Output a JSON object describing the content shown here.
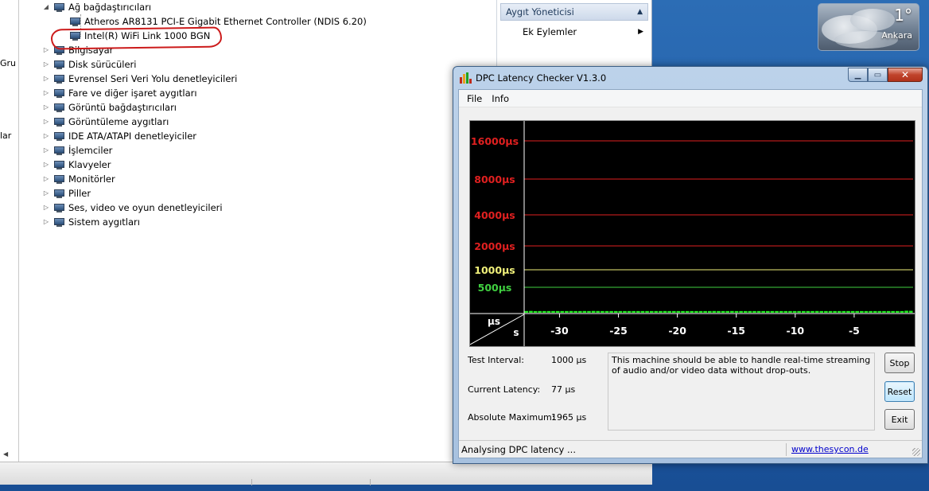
{
  "background_window": {
    "left_edge_texts": [
      "Gru",
      "lar"
    ],
    "tree": [
      {
        "label": "Ağ bağdaştırıcıları",
        "indent": 1,
        "expanded": true,
        "icon": "network-adapter-icon"
      },
      {
        "label": "Atheros AR8131 PCI-E Gigabit Ethernet Controller (NDIS 6.20)",
        "indent": 2,
        "expanded": null,
        "icon": "network-card-icon"
      },
      {
        "label": "Intel(R) WiFi Link 1000 BGN",
        "indent": 2,
        "expanded": null,
        "icon": "wifi-card-icon"
      },
      {
        "label": "Bilgisayar",
        "indent": 0,
        "expanded": false,
        "icon": "computer-icon"
      },
      {
        "label": "Disk sürücüleri",
        "indent": 0,
        "expanded": false,
        "icon": "disk-drive-icon"
      },
      {
        "label": "Evrensel Seri Veri Yolu denetleyicileri",
        "indent": 0,
        "expanded": false,
        "icon": "usb-icon"
      },
      {
        "label": "Fare ve diğer işaret aygıtları",
        "indent": 0,
        "expanded": false,
        "icon": "mouse-icon"
      },
      {
        "label": "Görüntü bağdaştırıcıları",
        "indent": 0,
        "expanded": false,
        "icon": "display-adapter-icon"
      },
      {
        "label": "Görüntüleme aygıtları",
        "indent": 0,
        "expanded": false,
        "icon": "camera-icon"
      },
      {
        "label": "IDE ATA/ATAPI denetleyiciler",
        "indent": 0,
        "expanded": false,
        "icon": "ide-controller-icon"
      },
      {
        "label": "İşlemciler",
        "indent": 0,
        "expanded": false,
        "icon": "processor-icon"
      },
      {
        "label": "Klavyeler",
        "indent": 0,
        "expanded": false,
        "icon": "keyboard-icon"
      },
      {
        "label": "Monitörler",
        "indent": 0,
        "expanded": false,
        "icon": "monitor-icon"
      },
      {
        "label": "Piller",
        "indent": 0,
        "expanded": false,
        "icon": "battery-icon"
      },
      {
        "label": "Ses, video ve oyun denetleyicileri",
        "indent": 0,
        "expanded": false,
        "icon": "speaker-icon"
      },
      {
        "label": "Sistem aygıtları",
        "indent": 0,
        "expanded": false,
        "icon": "system-device-icon"
      }
    ],
    "actions": {
      "header": "Aygıt Yöneticisi",
      "item": "Ek Eylemler"
    }
  },
  "weather": {
    "temperature": "1°",
    "city": "Ankara"
  },
  "dpc": {
    "title": "DPC Latency Checker V1.3.0",
    "menu": [
      "File",
      "Info"
    ],
    "test_interval_label": "Test Interval:",
    "test_interval_value": "1000 µs",
    "current_latency_label": "Current Latency:",
    "current_latency_value": "77 µs",
    "absolute_max_label": "Absolute Maximum:",
    "absolute_max_value": "1965 µs",
    "message": "This machine should be able to handle real-time streaming of audio and/or video data without drop-outs.",
    "buttons": {
      "stop": "Stop",
      "reset": "Reset",
      "exit": "Exit"
    },
    "status": "Analysing DPC latency ...",
    "link": "www.thesycon.de",
    "accent_colors": {
      "red": "#e02020",
      "yellow": "#f0f07a",
      "green": "#40d040",
      "bars": "#22ee22"
    }
  },
  "chart_data": {
    "type": "bar",
    "ylabel": "µs",
    "xlabel": "s",
    "y_reference_lines": [
      {
        "label": "16000µs",
        "value": 16000,
        "color": "red"
      },
      {
        "label": "8000µs",
        "value": 8000,
        "color": "red"
      },
      {
        "label": "4000µs",
        "value": 4000,
        "color": "red"
      },
      {
        "label": "2000µs",
        "value": 2000,
        "color": "red"
      },
      {
        "label": "1000µs",
        "value": 1000,
        "color": "yellow"
      },
      {
        "label": "500µs",
        "value": 500,
        "color": "green"
      }
    ],
    "x_ticks": [
      "-30",
      "-25",
      "-20",
      "-15",
      "-10",
      "-5"
    ],
    "x_range": [
      -33,
      0
    ],
    "values": [
      95,
      100,
      90,
      92,
      92,
      92,
      92,
      92,
      92,
      92,
      95,
      92,
      92,
      95,
      92,
      98,
      95,
      92,
      92,
      92,
      92,
      92,
      92,
      92,
      92,
      92,
      92,
      92,
      92,
      92,
      92,
      95,
      92,
      92,
      92,
      92,
      92,
      92,
      92,
      92,
      92,
      92,
      95,
      92,
      92,
      92,
      95,
      92,
      92,
      92,
      92,
      92,
      92,
      92,
      92,
      92,
      92,
      92,
      92,
      92,
      92,
      92,
      92,
      92,
      92,
      95,
      92,
      92,
      92,
      92,
      92,
      92,
      92,
      92,
      92,
      92,
      92,
      92,
      92,
      92,
      92,
      92,
      92,
      92,
      92,
      110,
      105
    ],
    "ylim": [
      0,
      17000
    ]
  }
}
